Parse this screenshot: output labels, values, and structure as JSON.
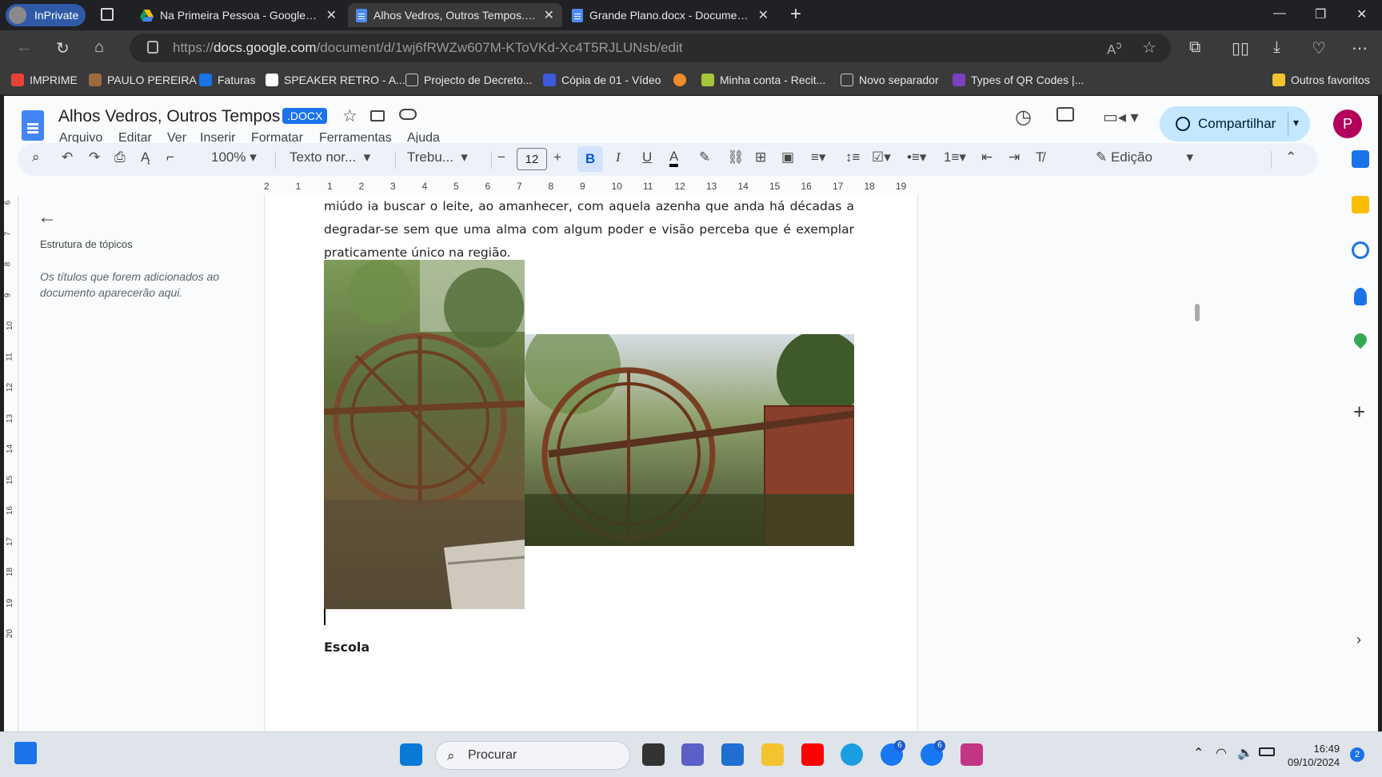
{
  "browser": {
    "inprivate_label": "InPrivate",
    "tabs": [
      {
        "title": "Na Primeira Pessoa - Google Drive"
      },
      {
        "title": "Alhos Vedros, Outros Tempos.docx"
      },
      {
        "title": "Grande Plano.docx - Documentos"
      }
    ],
    "url_prefix": "https://",
    "url_host": "docs.google.com",
    "url_path": "/document/d/1wj6fRWZw607M-KToVKd-Xc4T5RJLUNsb/edit",
    "bookmarks": [
      {
        "label": "IMPRIME",
        "color": "#ea4335"
      },
      {
        "label": "PAULO PEREIRA",
        "color": "#9c6b3c"
      },
      {
        "label": "Faturas",
        "color": "#1a73e8"
      },
      {
        "label": "SPEAKER RETRO - A...",
        "color": "#ffffff"
      },
      {
        "label": "Projecto de Decreto...",
        "color": "#cfcfcf"
      },
      {
        "label": "Cópia de 01 - Vídeo",
        "color": "#3b5bdb"
      },
      {
        "label": "",
        "color": "#f28c28"
      },
      {
        "label": "Minha conta - Recit...",
        "color": "#a4c639"
      },
      {
        "label": "Novo separador",
        "color": "#cfcfcf"
      },
      {
        "label": "Types of QR Codes |...",
        "color": "#7b3fbf"
      }
    ],
    "other_favorites": "Outros favoritos"
  },
  "doc": {
    "title": "Alhos Vedros, Outros Tempos",
    "badge": ".DOCX",
    "menus": [
      "Arquivo",
      "Editar",
      "Ver",
      "Inserir",
      "Formatar",
      "Ferramentas",
      "Ajuda"
    ],
    "share_label": "Compartilhar",
    "avatar_letter": "P",
    "toolbar": {
      "zoom": "100%",
      "style": "Texto nor...",
      "font": "Trebu...",
      "font_size": "12",
      "mode": "Edição"
    },
    "ruler_labels": [
      "2",
      "1",
      "1",
      "2",
      "3",
      "4",
      "5",
      "6",
      "7",
      "8",
      "9",
      "10",
      "11",
      "12",
      "13",
      "14",
      "15",
      "16",
      "17",
      "18",
      "19"
    ],
    "vruler_labels": [
      "6",
      "7",
      "8",
      "9",
      "10",
      "11",
      "12",
      "13",
      "14",
      "15",
      "16",
      "17",
      "18",
      "19",
      "20"
    ],
    "outline_title": "Estrutura de tópicos",
    "outline_empty": "Os títulos que forem adicionados ao documento aparecerão aqui.",
    "paragraph_lines": [
      "miúdo ia buscar o leite, ao amanhecer, com aquela azenha que anda há décadas a",
      "degradar-se sem que uma alma com algum poder e visão perceba que é exemplar",
      "praticamente único na região."
    ],
    "heading_next": "Escola"
  },
  "taskbar": {
    "search_placeholder": "Procurar",
    "time": "16:49",
    "date": "09/10/2024",
    "notification_count": "2",
    "badge_6a": "6",
    "badge_6b": "6"
  }
}
